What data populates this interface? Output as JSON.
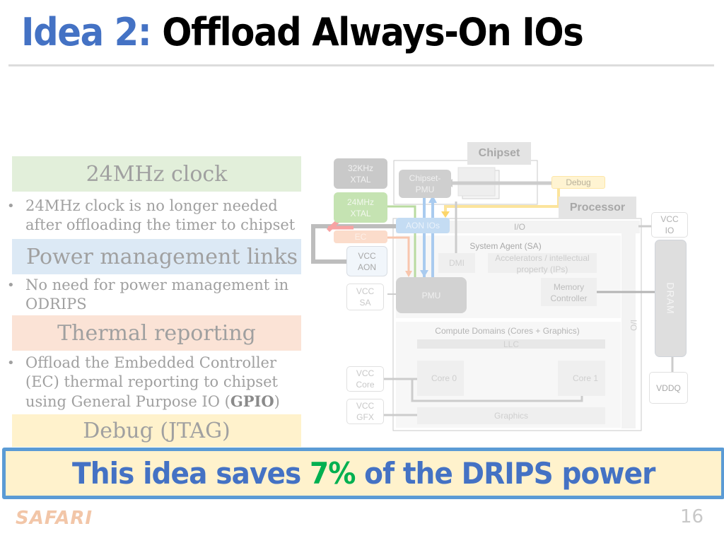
{
  "slide": {
    "title_lead": "Idea 2:",
    "title_rest": "Offload Always-On IOs",
    "page_number": "16",
    "logo": "SAFARI"
  },
  "sections": [
    {
      "heading": "24MHz clock",
      "bullet_parts": [
        "24MHz clock is no longer needed after offloading the timer to chipset"
      ]
    },
    {
      "heading": "Power management links",
      "bullet_parts": [
        "No need for power management in ODRIPS"
      ]
    },
    {
      "heading": "Thermal reporting",
      "bullet_parts": [
        "Offload the Embedded Controller (EC) thermal reporting to chipset using General Purpose IO (",
        "GPIO",
        ")"
      ]
    },
    {
      "heading": "Debug (JTAG)",
      "bullet_parts": []
    }
  ],
  "callout": {
    "before": "This idea saves",
    "highlight": "7%",
    "after": "of the DRIPS power",
    "colors": {
      "text": "#4472c4",
      "highlight": "#00b050",
      "border": "#5b9bd5",
      "background": "#fff2cc"
    }
  },
  "diagram": {
    "chipset_header": "Chipset",
    "processor_header": "Processor",
    "xtal_32": [
      "32KHz",
      "XTAL"
    ],
    "xtal_24": [
      "24MHz",
      "XTAL"
    ],
    "ec": "EC",
    "vcc_aon": [
      "VCC",
      "AON"
    ],
    "vcc_sa": [
      "VCC",
      "SA"
    ],
    "vcc_core": [
      "VCC",
      "Core"
    ],
    "vcc_gfx": [
      "VCC",
      "GFX"
    ],
    "vcc_io": [
      "VCC",
      "IO"
    ],
    "chipset_pmu": [
      "Chipset-",
      "PMU"
    ],
    "debug": "Debug",
    "aon_ios": "AON IOs",
    "io_top": "I/O",
    "io_side": "I/O",
    "system_agent": "System Agent (SA)",
    "dmi": "DMI",
    "accelerators": [
      "Accelerators / intellectual",
      "property (IPs)"
    ],
    "pmu": "PMU",
    "memory_controller": [
      "Memory",
      "Controller"
    ],
    "compute_domains": "Compute Domains (Cores + Graphics)",
    "llc": "LLC",
    "core0": "Core 0",
    "core1": "Core 1",
    "graphics": "Graphics",
    "dram": "DRAM",
    "vddq": "VDDQ"
  }
}
